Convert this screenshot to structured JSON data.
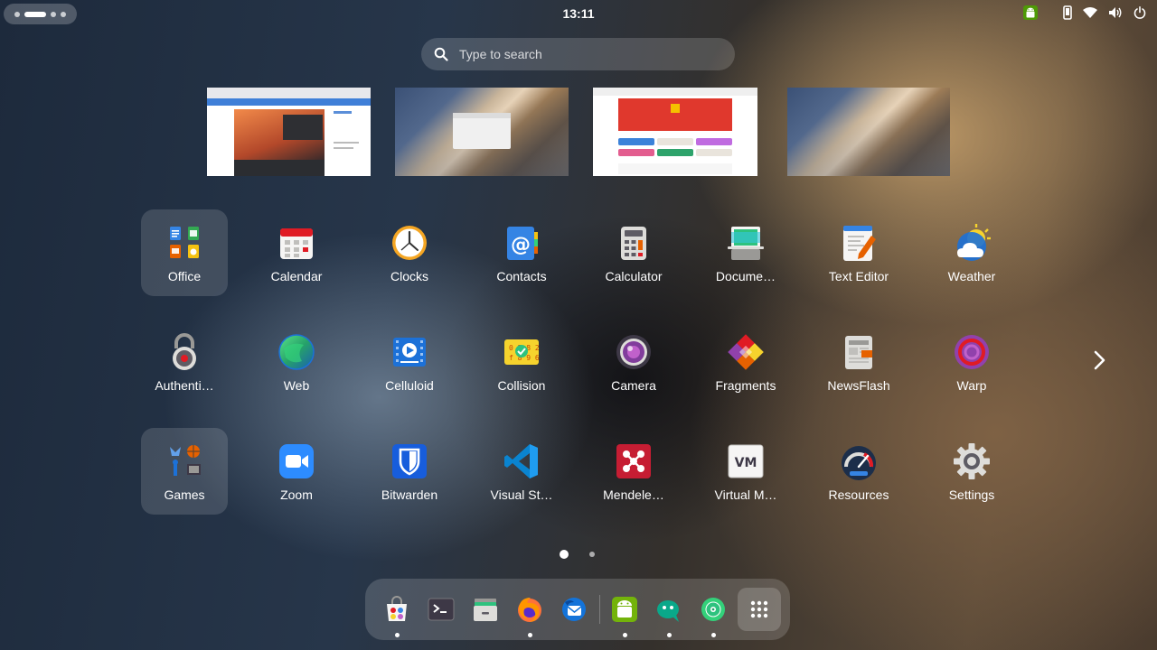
{
  "topbar": {
    "clock": "13:11",
    "tray_icons": [
      "android-icon",
      "phone-icon",
      "wifi-icon",
      "volume-icon",
      "power-icon"
    ]
  },
  "search": {
    "placeholder": "Type to search"
  },
  "windows": [
    "browser-window",
    "desktop-window",
    "app-window",
    "desktop-window"
  ],
  "apps": [
    {
      "label": "Office",
      "icon": "office-folder-icon",
      "folder": true
    },
    {
      "label": "Calendar",
      "icon": "calendar-icon"
    },
    {
      "label": "Clocks",
      "icon": "clock-icon"
    },
    {
      "label": "Contacts",
      "icon": "contacts-icon"
    },
    {
      "label": "Calculator",
      "icon": "calculator-icon"
    },
    {
      "label": "Docume…",
      "icon": "document-scanner-icon"
    },
    {
      "label": "Text Editor",
      "icon": "text-editor-icon"
    },
    {
      "label": "Weather",
      "icon": "weather-icon"
    },
    {
      "label": "Authenti…",
      "icon": "authenticator-icon"
    },
    {
      "label": "Web",
      "icon": "web-globe-icon"
    },
    {
      "label": "Celluloid",
      "icon": "celluloid-icon"
    },
    {
      "label": "Collision",
      "icon": "collision-icon"
    },
    {
      "label": "Camera",
      "icon": "camera-icon"
    },
    {
      "label": "Fragments",
      "icon": "fragments-icon"
    },
    {
      "label": "NewsFlash",
      "icon": "newsflash-icon"
    },
    {
      "label": "Warp",
      "icon": "warp-icon"
    },
    {
      "label": "Games",
      "icon": "games-folder-icon",
      "folder": true
    },
    {
      "label": "Zoom",
      "icon": "zoom-icon"
    },
    {
      "label": "Bitwarden",
      "icon": "bitwarden-icon"
    },
    {
      "label": "Visual St…",
      "icon": "vscode-icon"
    },
    {
      "label": "Mendele…",
      "icon": "mendeley-icon"
    },
    {
      "label": "Virtual M…",
      "icon": "virtual-machine-icon"
    },
    {
      "label": "Resources",
      "icon": "resources-icon"
    },
    {
      "label": "Settings",
      "icon": "settings-gear-icon"
    }
  ],
  "pagination": {
    "pages": 2,
    "current": 1
  },
  "dock": [
    {
      "name": "software-icon",
      "running": true
    },
    {
      "name": "terminal-icon",
      "running": false
    },
    {
      "name": "files-icon",
      "running": false
    },
    {
      "name": "firefox-icon",
      "running": true
    },
    {
      "name": "thunderbird-icon",
      "running": false
    },
    {
      "name": "android-app-icon",
      "running": true
    },
    {
      "name": "chat-icon",
      "running": true
    },
    {
      "name": "music-icon",
      "running": true
    },
    {
      "name": "show-apps-icon",
      "running": false
    }
  ],
  "colors": {
    "accent": "#3584e4",
    "folder_bg": "#ffffff24"
  }
}
